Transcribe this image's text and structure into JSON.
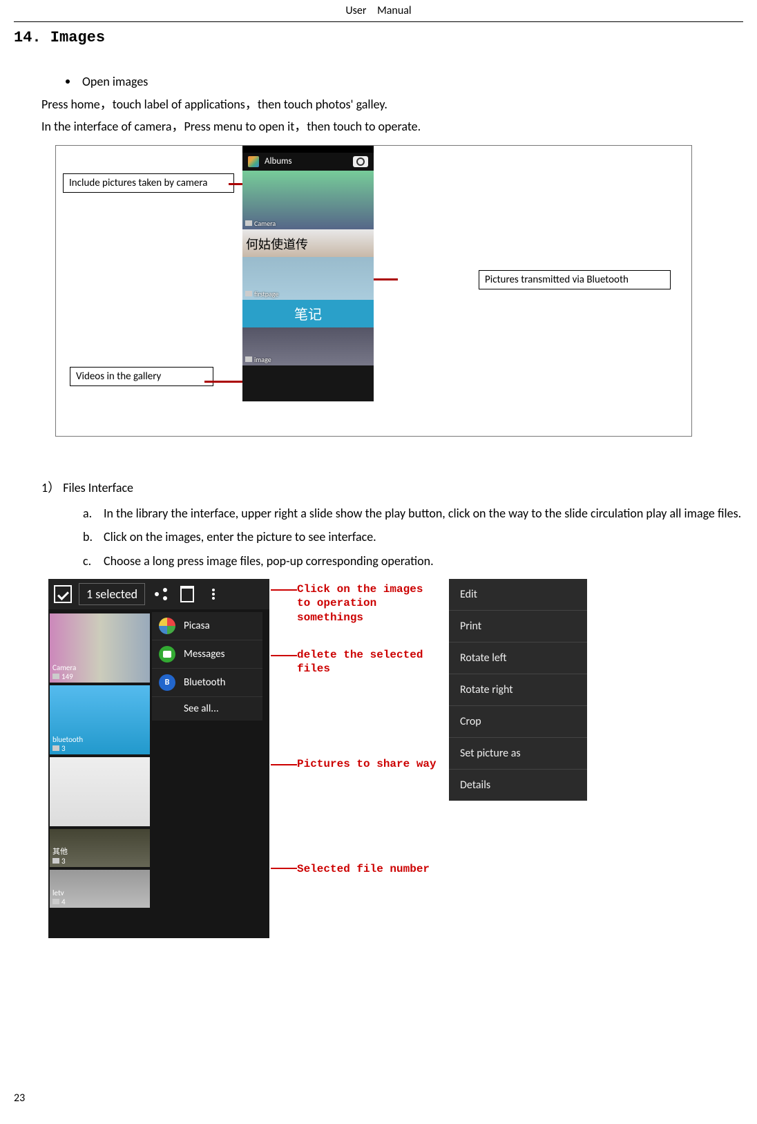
{
  "header": "User  Manual",
  "section_heading": "14. Images",
  "bullet": "Open images",
  "para1": "Press home，touch label of applications，then touch photos' galley.",
  "para2": "In the interface of camera，Press menu to open it，then touch to operate.",
  "fig1": {
    "title": "Albums",
    "callout1": "Include pictures taken by camera",
    "callout2": "Pictures transmitted via Bluetooth",
    "callout3": "Videos in the gallery",
    "album1_label": "Camera",
    "album3_label": "firstpage",
    "album4_text": "笔记",
    "album5_label": "image"
  },
  "sub": "1） Files Interface",
  "items": {
    "a_letter": "a.",
    "a": "In the library the interface, upper right a slide show the play button, click on the way to the slide circulation play all image files.",
    "b_letter": "b.",
    "b": "Click on the images, enter the picture to see interface.",
    "c_letter": "c.",
    "c": "Choose a long press image files, pop-up corresponding operation."
  },
  "fig2": {
    "selected": "1 selected",
    "share": {
      "picasa": "Picasa",
      "messages": "Messages",
      "bluetooth": "Bluetooth",
      "seeall": "See all..."
    },
    "labels": {
      "camera": "Camera",
      "camera_count": "149",
      "bluetooth": "bluetooth",
      "bluetooth_count": "3",
      "other": "其他",
      "other_count": "3",
      "letv": "letv",
      "letv_count": "4"
    },
    "annotations": {
      "r1": "Click on the images to operation somethings",
      "r2": "delete the selected files",
      "r3": "Pictures to share way",
      "r4": "Selected file number"
    },
    "context": {
      "edit": "Edit",
      "print": "Print",
      "rotleft": "Rotate left",
      "rotright": "Rotate right",
      "crop": "Crop",
      "setas": "Set picture as",
      "details": "Details"
    }
  },
  "page_number": "23"
}
